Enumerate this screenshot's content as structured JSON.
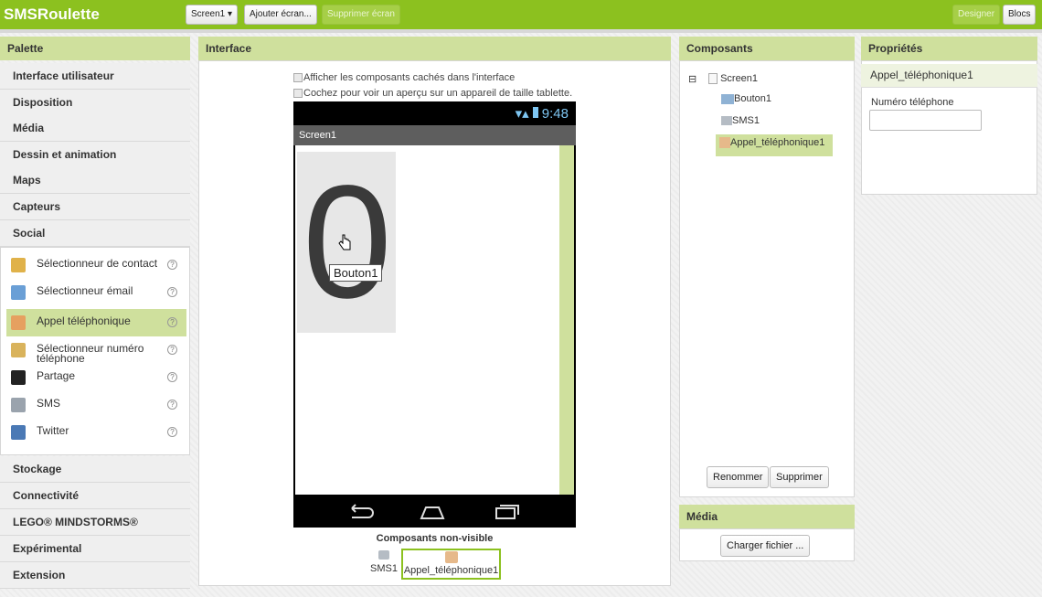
{
  "app": {
    "title": "SMSRoulette"
  },
  "toolbar": {
    "screen_select": "Screen1 ▾",
    "add_screen": "Ajouter écran...",
    "remove_screen": "Supprimer écran",
    "designer": "Designer",
    "blocks": "Blocs"
  },
  "palette": {
    "header": "Palette",
    "categories_top": [
      "Interface utilisateur",
      "Disposition",
      "Média",
      "Dessin et animation",
      "Maps",
      "Capteurs",
      "Social"
    ],
    "social_items": [
      {
        "label": "Sélectionneur de contact",
        "icon": "contact-picker-icon",
        "color": "#e0b24a"
      },
      {
        "label": "Sélectionneur émail",
        "icon": "email-picker-icon",
        "color": "#6a9fd6"
      },
      {
        "label": "Appel téléphonique",
        "icon": "phone-call-icon",
        "color": "#e6a060",
        "selected": true
      },
      {
        "label": "Sélectionneur numéro téléphone",
        "icon": "phone-number-picker-icon",
        "color": "#d9b35c"
      },
      {
        "label": "Partage",
        "icon": "share-icon",
        "color": "#222222"
      },
      {
        "label": "SMS",
        "icon": "sms-icon",
        "color": "#9aa3ad"
      },
      {
        "label": "Twitter",
        "icon": "twitter-icon",
        "color": "#4a79b5"
      }
    ],
    "help_glyph": "?",
    "categories_bottom": [
      "Stockage",
      "Connectivité",
      "LEGO® MINDSTORMS®",
      "Expérimental",
      "Extension"
    ]
  },
  "viewer": {
    "header": "Interface",
    "show_hidden": "Afficher les composants cachés dans l'interface",
    "tablet_preview": "Cochez pour voir un aperçu sur un appareil de taille tablette.",
    "status_time": "9:48",
    "screen_title": "Screen1",
    "button_text": "0",
    "tooltip": "Bouton1",
    "nonvisible_header": "Composants non-visible",
    "nonvisible": [
      "SMS1",
      "Appel_téléphonique1"
    ]
  },
  "components": {
    "header": "Composants",
    "tree": [
      "Screen1",
      "Bouton1",
      "SMS1",
      "Appel_téléphonique1"
    ],
    "rename": "Renommer",
    "delete": "Supprimer"
  },
  "media": {
    "header": "Média",
    "upload": "Charger fichier ..."
  },
  "properties": {
    "header": "Propriétés",
    "component": "Appel_téléphonique1",
    "phone_label": "Numéro téléphone",
    "phone_value": ""
  },
  "colors": {
    "accent": "#8cc11f",
    "header_bg": "#cfe09d"
  }
}
